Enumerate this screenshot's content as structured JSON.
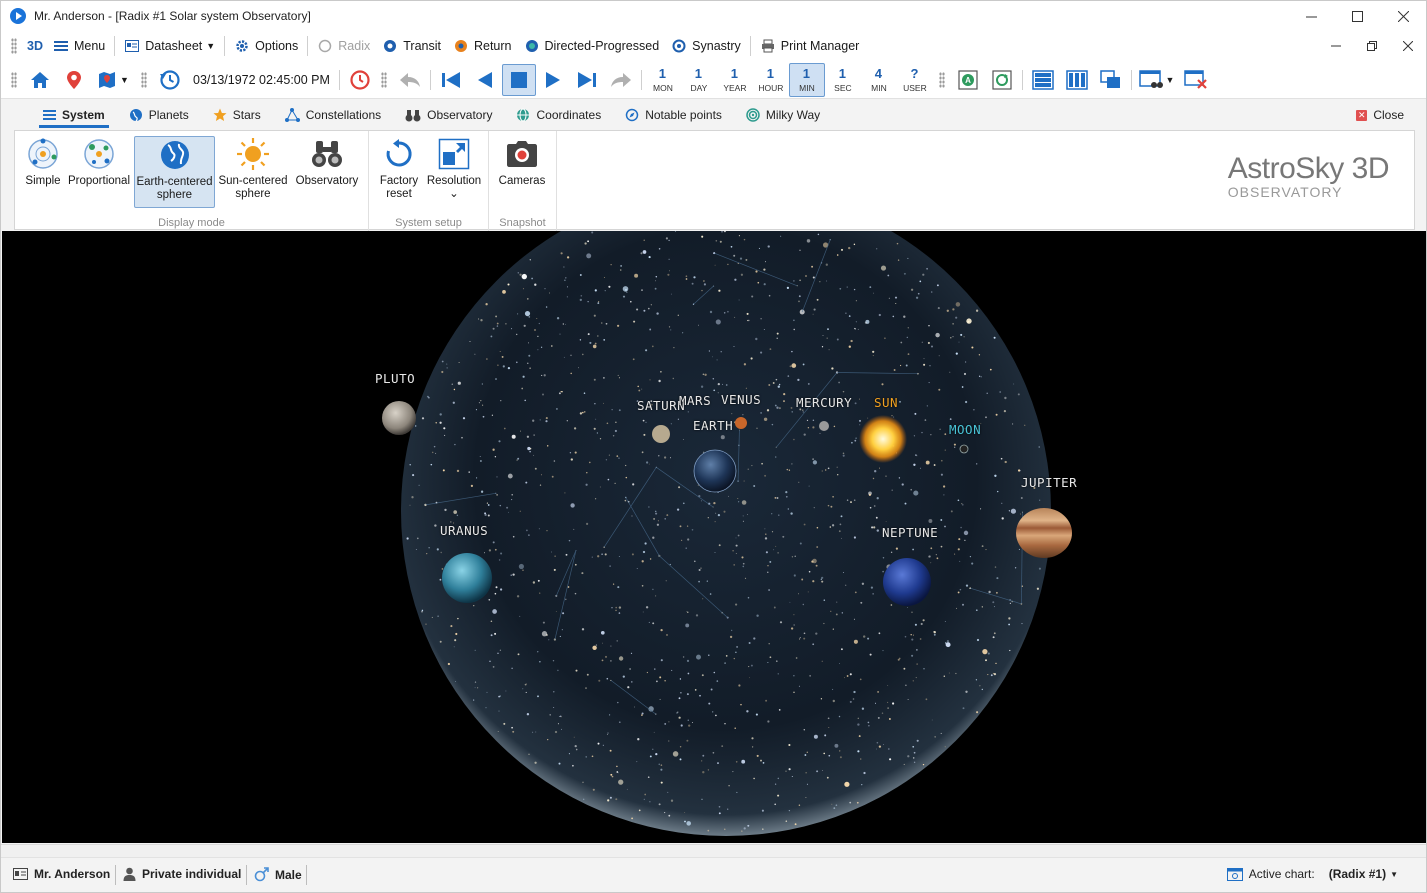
{
  "window": {
    "title": "Mr. Anderson - [Radix #1 Solar system Observatory]"
  },
  "menu": {
    "items": [
      {
        "label": "Menu",
        "icon": "hamburger-icon"
      },
      {
        "label": "Datasheet",
        "icon": "datasheet-icon"
      },
      {
        "label": "Options",
        "icon": "gear-icon"
      },
      {
        "label": "Radix",
        "icon": "radix-icon",
        "disabled": true
      },
      {
        "label": "Transit",
        "icon": "transit-icon"
      },
      {
        "label": "Return",
        "icon": "return-icon"
      },
      {
        "label": "Directed-Progressed",
        "icon": "directed-icon"
      },
      {
        "label": "Synastry",
        "icon": "synastry-icon"
      },
      {
        "label": "Print Manager",
        "icon": "printer-icon"
      }
    ],
    "logo_3d": "3D"
  },
  "toolbar": {
    "datetime": "03/13/1972 02:45:00 PM",
    "steps": [
      {
        "num": "1",
        "label": "MON"
      },
      {
        "num": "1",
        "label": "DAY"
      },
      {
        "num": "1",
        "label": "YEAR"
      },
      {
        "num": "1",
        "label": "HOUR"
      },
      {
        "num": "1",
        "label": "MIN",
        "selected": true
      },
      {
        "num": "1",
        "label": "SEC"
      },
      {
        "num": "4",
        "label": "MIN"
      },
      {
        "num": "?",
        "label": "USER"
      }
    ]
  },
  "tabs": [
    {
      "label": "System",
      "active": true,
      "icon": "list-icon"
    },
    {
      "label": "Planets",
      "icon": "globe-icon"
    },
    {
      "label": "Stars",
      "icon": "star-icon"
    },
    {
      "label": "Constellations",
      "icon": "constellation-icon"
    },
    {
      "label": "Observatory",
      "icon": "binoculars-icon"
    },
    {
      "label": "Coordinates",
      "icon": "coordinates-icon"
    },
    {
      "label": "Notable points",
      "icon": "notable-points-icon"
    },
    {
      "label": "Milky Way",
      "icon": "milky-way-icon"
    }
  ],
  "close_label": "Close",
  "ribbon": {
    "display_mode": {
      "label": "Display mode",
      "buttons": [
        {
          "label1": "Simple",
          "label2": ""
        },
        {
          "label1": "Proportional",
          "label2": ""
        },
        {
          "label1": "Earth-centered",
          "label2": "sphere",
          "selected": true
        },
        {
          "label1": "Sun-centered",
          "label2": "sphere"
        },
        {
          "label1": "Observatory",
          "label2": ""
        }
      ]
    },
    "system_setup": {
      "label": "System setup",
      "buttons": [
        {
          "label1": "Factory",
          "label2": "reset"
        },
        {
          "label1": "Resolution",
          "label2": "⌄"
        }
      ]
    },
    "snapshot": {
      "label": "Snapshot",
      "buttons": [
        {
          "label1": "Cameras",
          "label2": ""
        }
      ]
    },
    "brand": {
      "line1": "AstroSky 3D",
      "line2": "OBSERVATORY"
    }
  },
  "viewport": {
    "labels": [
      {
        "name": "PLUTO",
        "color": "#e8e8e8"
      },
      {
        "name": "SATURN",
        "color": "#e8e8e8"
      },
      {
        "name": "MARS",
        "color": "#e8e8e8"
      },
      {
        "name": "VENUS",
        "color": "#e8e8e8"
      },
      {
        "name": "EARTH",
        "color": "#e8e8e8"
      },
      {
        "name": "MERCURY",
        "color": "#e8e8e8"
      },
      {
        "name": "SUN",
        "color": "#f0a020"
      },
      {
        "name": "MOON",
        "color": "#49c3d6"
      },
      {
        "name": "JUPITER",
        "color": "#e8e8e8"
      },
      {
        "name": "URANUS",
        "color": "#e8e8e8"
      },
      {
        "name": "NEPTUNE",
        "color": "#e8e8e8"
      }
    ]
  },
  "status": {
    "name": "Mr. Anderson",
    "type": "Private individual",
    "gender": "Male",
    "active_chart_label": "Active chart:",
    "active_chart_value": "(Radix #1)"
  }
}
